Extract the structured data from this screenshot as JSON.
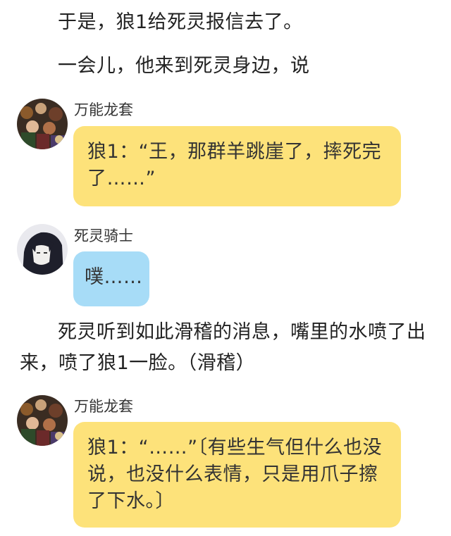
{
  "colors": {
    "yellow_bubble": "#fde27a",
    "blue_bubble": "#a7dcf7",
    "text": "#222222"
  },
  "story": {
    "line1": "于是，狼1给死灵报信去了。",
    "line2": "一会儿，他来到死灵身边，说",
    "line3": "死灵听到如此滑稽的消息，嘴里的水喷了出来，喷了狼1一脸。（滑稽）"
  },
  "messages": [
    {
      "sender": "万能龙套",
      "avatar": "group-characters-avatar",
      "text": "狼1：“王，那群羊跳崖了，摔死完了……”"
    },
    {
      "sender": "死灵骑士",
      "avatar": "dark-knight-avatar",
      "text": "噗……"
    },
    {
      "sender": "万能龙套",
      "avatar": "group-characters-avatar",
      "text": "狼1：“……”〔有些生气但什么也没说，也没什么表情，只是用爪子擦了下水。〕"
    }
  ]
}
